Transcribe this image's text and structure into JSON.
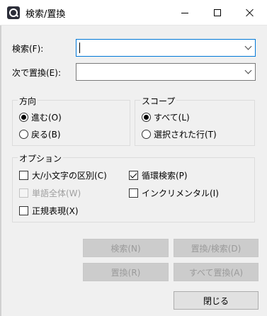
{
  "window": {
    "title": "検索/置換"
  },
  "find": {
    "label": "検索(F):",
    "value": ""
  },
  "replace": {
    "label": "次で置換(E):",
    "value": ""
  },
  "direction": {
    "title": "方向",
    "options": [
      {
        "label": "進む(O)",
        "selected": true
      },
      {
        "label": "戻る(B)",
        "selected": false
      }
    ]
  },
  "scope": {
    "title": "スコープ",
    "options": [
      {
        "label": "すべて(L)",
        "selected": true
      },
      {
        "label": "選択された行(T)",
        "selected": false
      }
    ]
  },
  "options": {
    "title": "オプション",
    "case_sensitive": {
      "label": "大/小文字の区別(C)",
      "checked": false
    },
    "wrap_search": {
      "label": "循環検索(P)",
      "checked": true
    },
    "whole_word": {
      "label": "単語全体(W)",
      "checked": false,
      "enabled": false
    },
    "incremental": {
      "label": "インクリメンタル(I)",
      "checked": false
    },
    "regex": {
      "label": "正規表現(X)",
      "checked": false
    }
  },
  "buttons": {
    "find": "検索(N)",
    "replace_find": "置換/検索(D)",
    "replace": "置換(R)",
    "replace_all": "すべて置換(A)",
    "close": "閉じる"
  },
  "colors": {
    "focus_border": "#0078d7",
    "disabled_text": "#a0a0a0"
  }
}
